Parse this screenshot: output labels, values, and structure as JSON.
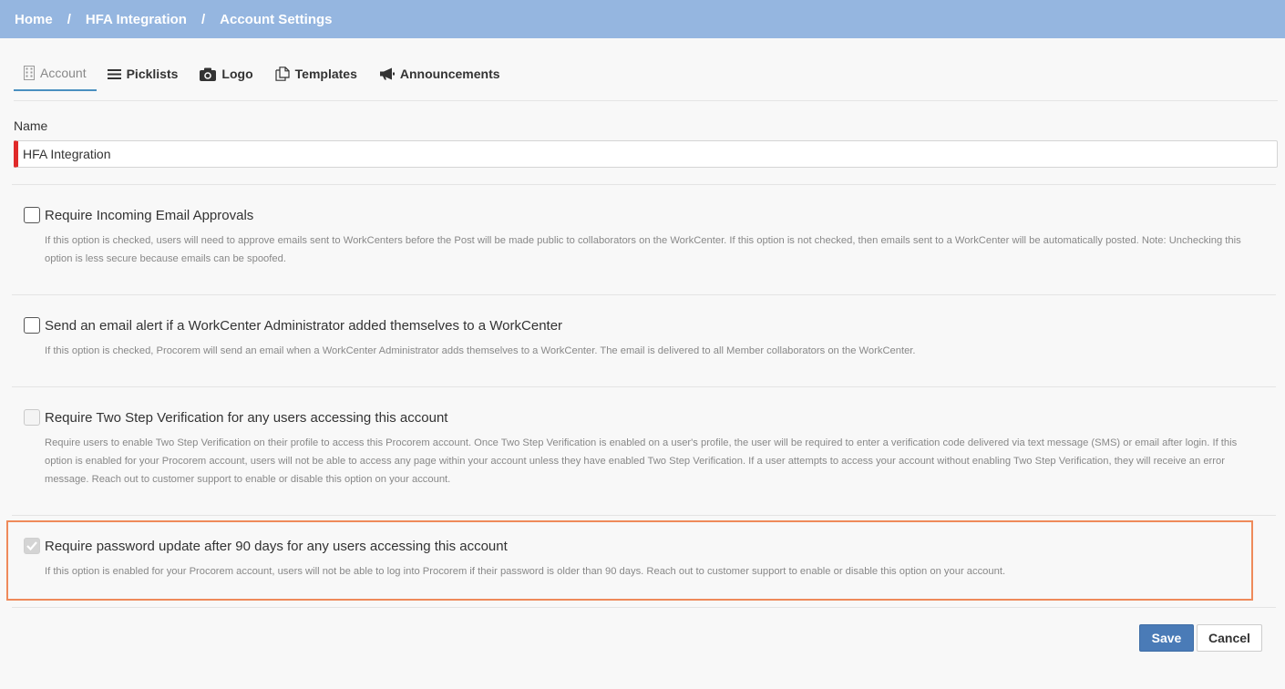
{
  "breadcrumb": {
    "items": [
      "Home",
      "HFA Integration",
      "Account Settings"
    ],
    "separator": "/"
  },
  "tabs": [
    {
      "label": "Account",
      "icon": "building-icon",
      "active": true
    },
    {
      "label": "Picklists",
      "icon": "list-icon"
    },
    {
      "label": "Logo",
      "icon": "camera-icon"
    },
    {
      "label": "Templates",
      "icon": "copy-icon"
    },
    {
      "label": "Announcements",
      "icon": "megaphone-icon"
    }
  ],
  "name_field": {
    "label": "Name",
    "value": "HFA Integration"
  },
  "options": [
    {
      "title": "Require Incoming Email Approvals",
      "description": "If this option is checked, users will need to approve emails sent to WorkCenters before the Post will be made public to collaborators on the WorkCenter. If this option is not checked, then emails sent to a WorkCenter will be automatically posted. Note: Unchecking this option is less secure because emails can be spoofed.",
      "checked": false,
      "disabled": false
    },
    {
      "title": "Send an email alert if a WorkCenter Administrator added themselves to a WorkCenter",
      "description": "If this option is checked, Procorem will send an email when a WorkCenter Administrator adds themselves to a WorkCenter. The email is delivered to all Member collaborators on the WorkCenter.",
      "checked": false,
      "disabled": false
    },
    {
      "title": "Require Two Step Verification for any users accessing this account",
      "description": "Require users to enable Two Step Verification on their profile to access this Procorem account. Once Two Step Verification is enabled on a user's profile, the user will be required to enter a verification code delivered via text message (SMS) or email after login. If this option is enabled for your Procorem account, users will not be able to access any page within your account unless they have enabled Two Step Verification. If a user attempts to access your account without enabling Two Step Verification, they will receive an error message. Reach out to customer support to enable or disable this option on your account.",
      "checked": false,
      "disabled": true
    },
    {
      "title": "Require password update after 90 days for any users accessing this account",
      "description": "If this option is enabled for your Procorem account, users will not be able to log into Procorem if their password is older than 90 days. Reach out to customer support to enable or disable this option on your account.",
      "checked": true,
      "disabled": true
    }
  ],
  "actions": {
    "save_label": "Save",
    "cancel_label": "Cancel"
  },
  "colors": {
    "header_bg": "#95b6e0",
    "primary_button": "#4a7bb7",
    "required_marker": "#e02a2a",
    "highlight_border": "#ef8a5a"
  }
}
